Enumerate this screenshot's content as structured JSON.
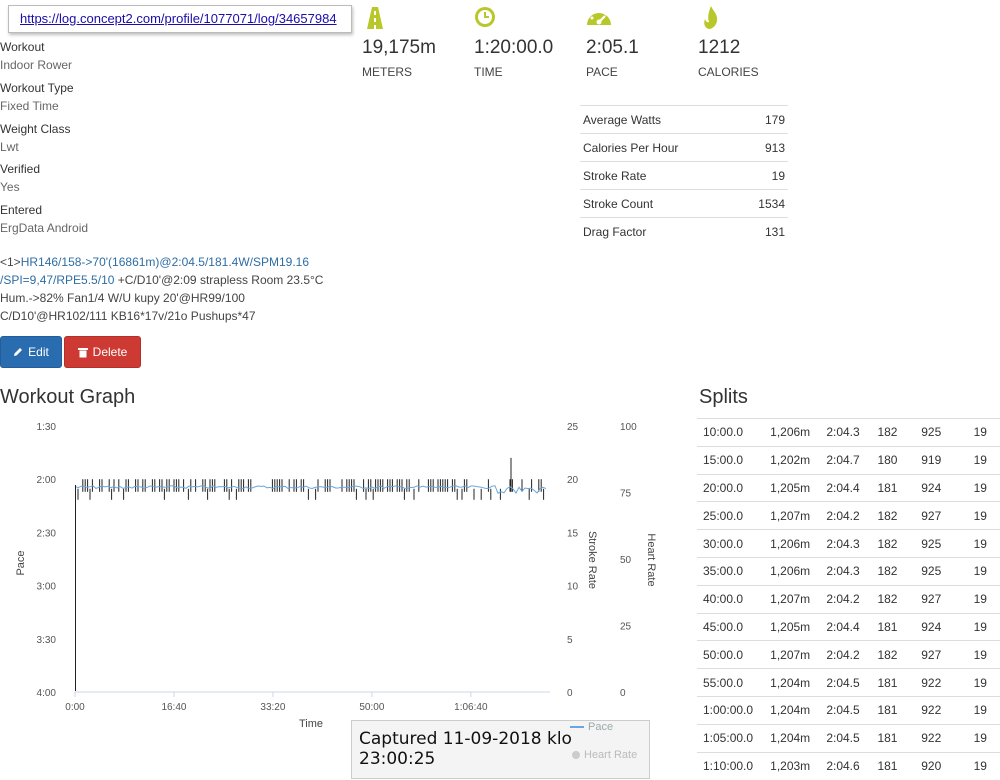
{
  "address_bar": {
    "url": "https://log.concept2.com/profile/1077071/log/34657984"
  },
  "details": [
    {
      "label": "Workout",
      "value": "Indoor Rower"
    },
    {
      "label": "Workout Type",
      "value": "Fixed Time"
    },
    {
      "label": "Weight Class",
      "value": "Lwt"
    },
    {
      "label": "Verified",
      "value": "Yes"
    },
    {
      "label": "Entered",
      "value": "ErgData Android"
    }
  ],
  "stats": [
    {
      "icon": "road-icon",
      "value": "19,175m",
      "caption": "METERS"
    },
    {
      "icon": "clock-icon",
      "value": "1:20:00.0",
      "caption": "TIME"
    },
    {
      "icon": "speedometer-icon",
      "value": "2:05.1",
      "caption": "PACE"
    },
    {
      "icon": "flame-icon",
      "value": "1212",
      "caption": "CALORIES"
    }
  ],
  "metrics": [
    {
      "label": "Average Watts",
      "value": "179"
    },
    {
      "label": "Calories Per Hour",
      "value": "913"
    },
    {
      "label": "Stroke Rate",
      "value": "19"
    },
    {
      "label": "Stroke Count",
      "value": "1534"
    },
    {
      "label": "Drag Factor",
      "value": "131"
    }
  ],
  "comment": {
    "prefix": "<1>",
    "link1": "HR146/158->70'(16861m)@2:04.5/181.4W/SPM19.16",
    "link2": "/SPI=9,47/RPE5.5/10",
    "rest_line1": " +C/D10'@2:09 strapless Room 23.5°C",
    "line3": "Hum.->82% Fan1/4 W/U kupy 20'@HR99/100",
    "line4": "C/D10'@HR102/111 KB16*17v/21o Pushups*47"
  },
  "buttons": {
    "edit": "Edit",
    "delete": "Delete"
  },
  "graph": {
    "title": "Workout Graph"
  },
  "splits": {
    "title": "Splits",
    "rows": [
      [
        "10:00.0",
        "1,206m",
        "2:04.3",
        "182",
        "925",
        "19"
      ],
      [
        "15:00.0",
        "1,202m",
        "2:04.7",
        "180",
        "919",
        "19"
      ],
      [
        "20:00.0",
        "1,205m",
        "2:04.4",
        "181",
        "924",
        "19"
      ],
      [
        "25:00.0",
        "1,207m",
        "2:04.2",
        "182",
        "927",
        "19"
      ],
      [
        "30:00.0",
        "1,206m",
        "2:04.3",
        "182",
        "925",
        "19"
      ],
      [
        "35:00.0",
        "1,206m",
        "2:04.3",
        "182",
        "925",
        "19"
      ],
      [
        "40:00.0",
        "1,207m",
        "2:04.2",
        "182",
        "927",
        "19"
      ],
      [
        "45:00.0",
        "1,205m",
        "2:04.4",
        "181",
        "924",
        "19"
      ],
      [
        "50:00.0",
        "1,207m",
        "2:04.2",
        "182",
        "927",
        "19"
      ],
      [
        "55:00.0",
        "1,204m",
        "2:04.5",
        "181",
        "922",
        "19"
      ],
      [
        "1:00:00.0",
        "1,204m",
        "2:04.5",
        "181",
        "922",
        "19"
      ],
      [
        "1:05:00.0",
        "1,204m",
        "2:04.5",
        "181",
        "922",
        "19"
      ],
      [
        "1:10:00.0",
        "1,203m",
        "2:04.6",
        "181",
        "920",
        "19"
      ]
    ]
  },
  "overlay": {
    "caption": "Captured 11-09-2018 klo 23:00:25"
  },
  "colors": {
    "accent": "#b8c82a",
    "link": "#2e6da4",
    "edit_button": "#2a6cb0",
    "delete_button": "#cc3a33",
    "pace_line": "#6aa6db",
    "stroke_bars": "#222222"
  },
  "chart_data": {
    "type": "line",
    "x_ticks": [
      "0:00",
      "16:40",
      "33:20",
      "50:00",
      "1:06:40"
    ],
    "xlabel": "Time",
    "xlim": [
      "0:00",
      "1:20:00"
    ],
    "y_axes": [
      {
        "label": "Pace",
        "ticks": [
          "1:30",
          "2:00",
          "2:30",
          "3:00",
          "3:30",
          "4:00"
        ],
        "range": [
          "1:30",
          "4:00"
        ],
        "inverted": true
      },
      {
        "label": "Stroke Rate",
        "ticks": [
          "25",
          "20",
          "15",
          "10",
          "5",
          "0"
        ],
        "range": [
          0,
          25
        ]
      },
      {
        "label": "Heart Rate",
        "ticks": [
          "100",
          "75",
          "50",
          "25",
          "0"
        ],
        "range": [
          0,
          100
        ]
      }
    ],
    "series": [
      {
        "name": "Pace",
        "style": "line"
      },
      {
        "name": "Heart Rate",
        "style": "line"
      }
    ],
    "stroke_rate_baseline": 19,
    "stroke_rate_spikes_max": 20,
    "pace_typical": "2:04.5",
    "legend_position": "bottom-right",
    "grid": false
  }
}
